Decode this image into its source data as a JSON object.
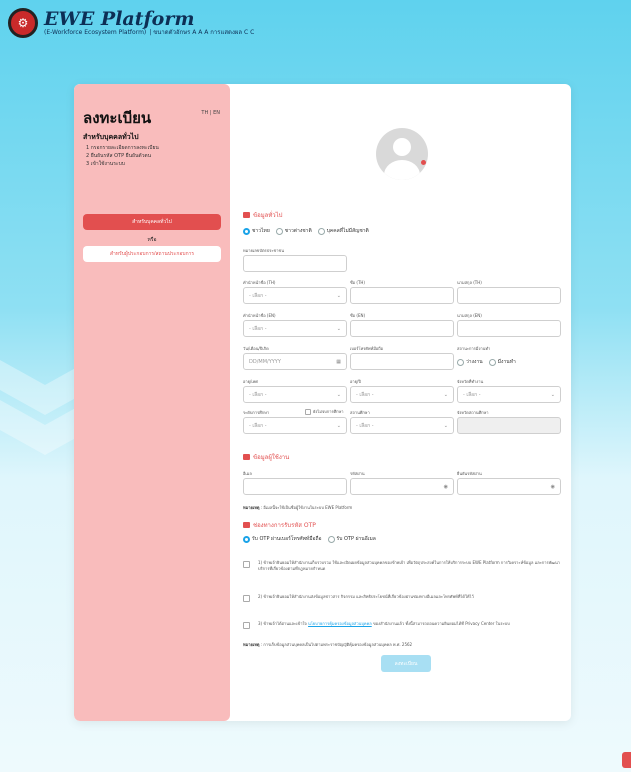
{
  "header": {
    "title": "EWE Platform",
    "subtitle": "(E-Workforce Ecosystem Platform)",
    "font_controls": "| ขนาดตัวอักษร A A A  การแสดงผล  C C"
  },
  "left": {
    "title": "ลงทะเบียน",
    "lang": "TH | EN",
    "subtitle": "สำหรับบุคคลทั่วไป",
    "steps": [
      "1  กรอกรายละเอียดการลงทะเบียน",
      "2  ยืนยันรหัส OTP ยืนยันตัวตน",
      "3  เข้าใช้งานระบบ"
    ],
    "primary_button": "สำหรับบุคคลทั่วไป",
    "or": "หรือ",
    "secondary_button": "สำหรับผู้ประกอบการ/สถานประกอบการ"
  },
  "general": {
    "heading": "ข้อมูลทั่วไป",
    "radios": [
      "ชาวไทย",
      "ชาวต่างชาติ",
      "บุคคลที่ไม่มีสัญชาติ"
    ],
    "id_label": "หมายเลขบัตรประชาชน",
    "prefix_th": "คำนำหน้าชื่อ (TH)",
    "name_th": "ชื่อ (TH)",
    "surname_th": "นามสกุล (TH)",
    "prefix_en": "คำนำหน้าชื่อ (EN)",
    "name_en": "ชื่อ (EN)",
    "surname_en": "นามสกุล (EN)",
    "select_placeholder": "- เลือก -",
    "dob": "วัน/เดือน/ปีเกิด",
    "dob_placeholder": "DD/MM/YYYY",
    "phone": "เบอร์โทรศัพท์มือถือ",
    "employment": "สถานะการมีงานทำ",
    "emp_options": [
      "ว่างงาน",
      "มีงานทำ"
    ],
    "gender": "อายุ/เพศ",
    "age": "อายุ/ปี",
    "province": "จังหวัดที่ทำงาน",
    "education": "ระดับการศึกษา",
    "edu_check": "ยังไม่จบการศึกษา",
    "institution": "สถานศึกษา",
    "inst_province": "จังหวัดสถานศึกษา"
  },
  "user": {
    "heading": "ข้อมูลผู้ใช้งาน",
    "email": "อีเมล",
    "password": "รหัสผ่าน",
    "confirm": "ยืนยันรหัสผ่าน",
    "note_label": "หมายเหตุ",
    "note": " : อีเมลนี้จะใช้เป็นชื่อผู้ใช้งานในระบบ EWE Platform"
  },
  "otp": {
    "heading": "ช่องทางการรับรหัส OTP",
    "options": [
      "รับ OTP ผ่านเบอร์โทรศัพท์มือถือ",
      "รับ OTP ผ่านอีเมล"
    ],
    "consent1": "1) ข้าพเจ้ายินยอมให้สำนักงานเก็บรวบรวม ใช้และเปิดเผยข้อมูลส่วนบุคคลของข้าพเจ้า เพื่อวัตถุประสงค์ในการให้บริการระบบ EWE Platform การวิเคราะห์ข้อมูล และการพัฒนาบริการที่เกี่ยวข้องตามที่กฎหมายกำหนด",
    "consent2": "2) ข้าพเจ้ายินยอมให้สำนักงานส่งข้อมูลข่าวสาร กิจกรรม และสิทธิประโยชน์ที่เกี่ยวข้องผ่านช่องทางอีเมลและโทรศัพท์ที่ได้ให้ไว้",
    "consent3a": "3) ข้าพเจ้าได้อ่านและเข้าใจ ",
    "consent3_link": "นโยบายการคุ้มครองข้อมูลส่วนบุคคล",
    "consent3b": " ของสำนักงานแล้ว ทั้งนี้สามารถถอนความยินยอมได้ที่ Privacy Center ในระบบ",
    "footer_label": "หมายเหตุ",
    "footer": " : การเก็บข้อมูลส่วนบุคคลเป็นไปตามพระราชบัญญัติคุ้มครองข้อมูลส่วนบุคคล พ.ศ. 2562",
    "submit": "ลงทะเบียน"
  },
  "colors": {
    "accent": "#e24f4f",
    "link": "#1aa3e8"
  }
}
